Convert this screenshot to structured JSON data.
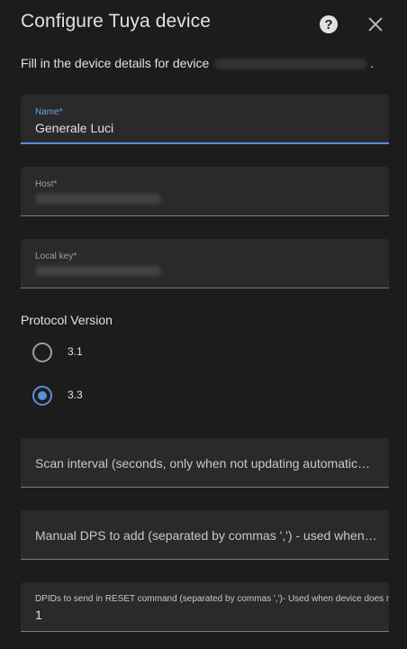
{
  "dialog": {
    "title": "Configure Tuya device",
    "description": "Fill in the device details for device",
    "description_suffix": "."
  },
  "fields": {
    "name": {
      "label": "Name*",
      "value": "Generale Luci"
    },
    "host": {
      "label": "Host*"
    },
    "local_key": {
      "label": "Local key*"
    },
    "scan_interval": {
      "placeholder": "Scan interval (seconds, only when not updating automatic…"
    },
    "manual_dps": {
      "placeholder": "Manual DPS to add (separated by commas ',') - used when …"
    },
    "reset_dpids": {
      "label": "DPIDs to send in RESET command (separated by commas ',')- Used when device does n",
      "value": "1"
    }
  },
  "protocol": {
    "title": "Protocol Version",
    "options": [
      {
        "label": "3.1",
        "checked": false
      },
      {
        "label": "3.3",
        "checked": true
      }
    ]
  },
  "colors": {
    "background": "#1c1c1c",
    "field_bg": "#2a2a2a",
    "accent": "#5b8fd6"
  },
  "icons": {
    "help": "help-circle-icon",
    "close": "close-icon"
  }
}
